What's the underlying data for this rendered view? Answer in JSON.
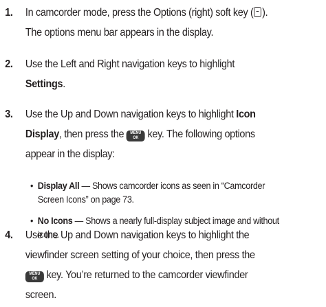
{
  "steps": [
    {
      "number": "1.",
      "line1_text": "In camcorder mode, press the Options (right) soft key (",
      "line1_end": ").",
      "line2": "The options menu bar appears in the display."
    },
    {
      "number": "2.",
      "line1": "Use the Left and Right navigation keys to highlight",
      "line2_bold": "Settings",
      "line2_end": "."
    },
    {
      "number": "3.",
      "line1_text": "Use the Up and Down navigation keys to highlight ",
      "line1_bold": "Icon",
      "line2_bold": "Display",
      "line2_mid": ", then press the ",
      "line2_end": " key. The following options",
      "line3": "appear in the display:"
    },
    {
      "number": "4.",
      "line1": "Use the Up and Down navigation keys to highlight the",
      "line2": "viewfinder screen setting of your choice, then press the",
      "line3_end": " key. You’re returned to the camcorder viewfinder",
      "line4": "screen."
    }
  ],
  "bullets": [
    {
      "bullet": "•",
      "title": "Display All",
      "line1": " — Shows camcorder icons as seen in “Camcorder",
      "line2": "Screen Icons” on page 73."
    },
    {
      "bullet": "•",
      "title": "No Icons",
      "line1": " — Shows a nearly full-display subject image and without",
      "line2": "icons."
    }
  ],
  "icons": {
    "options_soft_key": "right-soft-key-icon",
    "menu_ok_key": "menu-ok-key-icon"
  },
  "menu_key": {
    "top": "MENU",
    "bottom": "OK"
  },
  "colors": {
    "text": "#231f20",
    "key_background": "#3a3a3a"
  }
}
